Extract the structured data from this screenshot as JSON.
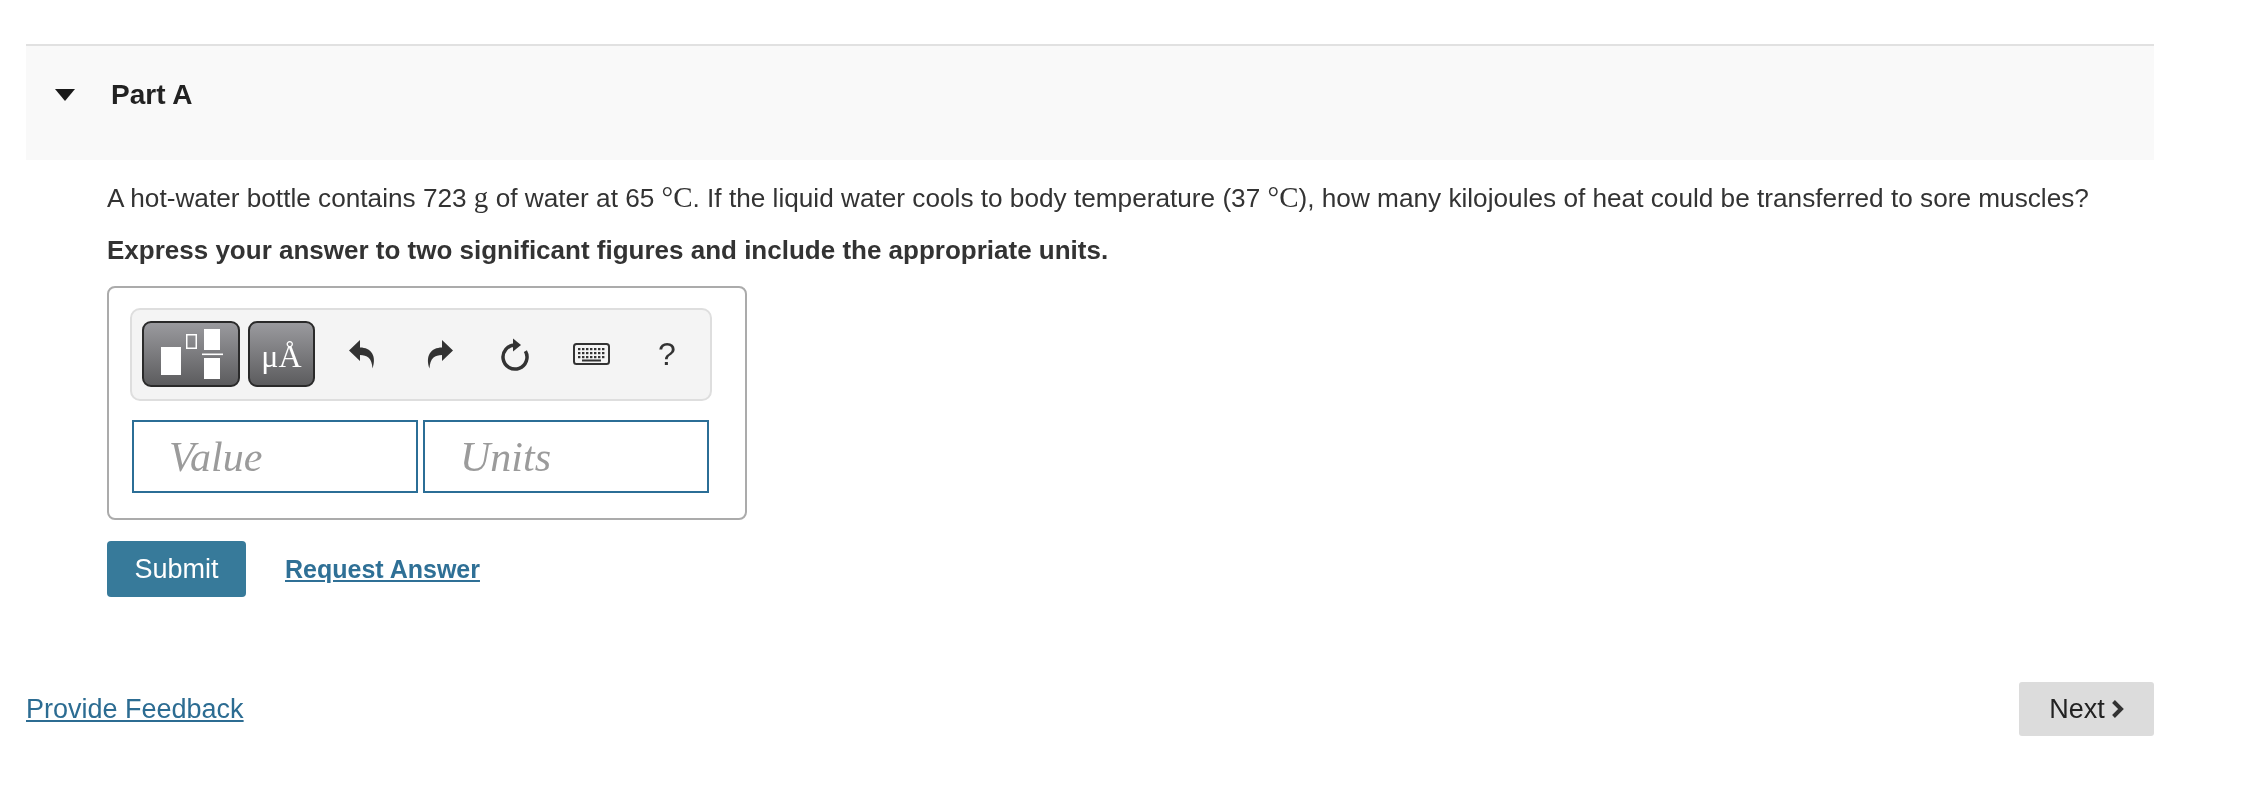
{
  "part": {
    "title": "Part A",
    "expanded": true
  },
  "question": {
    "segments": [
      {
        "kind": "text",
        "text": "A hot-water bottle contains 723 "
      },
      {
        "kind": "math",
        "text": "g"
      },
      {
        "kind": "text",
        "text": " of water at 65 "
      },
      {
        "kind": "math",
        "text": "°C"
      },
      {
        "kind": "text",
        "text": ". If the liquid water cools to body temperature (37 "
      },
      {
        "kind": "math",
        "text": "°C"
      },
      {
        "kind": "text",
        "text": "), how many kilojoules of heat could be transferred to sore muscles?"
      }
    ]
  },
  "instruction": "Express your answer to two significant figures and include the appropriate units.",
  "answer": {
    "toolbar": [
      {
        "kind": "templates"
      },
      {
        "kind": "symbols",
        "label": "μÅ"
      },
      {
        "kind": "undo"
      },
      {
        "kind": "redo"
      },
      {
        "kind": "reset"
      },
      {
        "kind": "keyboard"
      },
      {
        "kind": "help",
        "label": "?"
      }
    ],
    "fields": [
      {
        "placeholder": "Value"
      },
      {
        "placeholder": "Units"
      }
    ]
  },
  "actions": {
    "submit": "Submit",
    "request_answer": "Request Answer"
  },
  "footer": {
    "feedback": "Provide Feedback",
    "next": "Next"
  }
}
